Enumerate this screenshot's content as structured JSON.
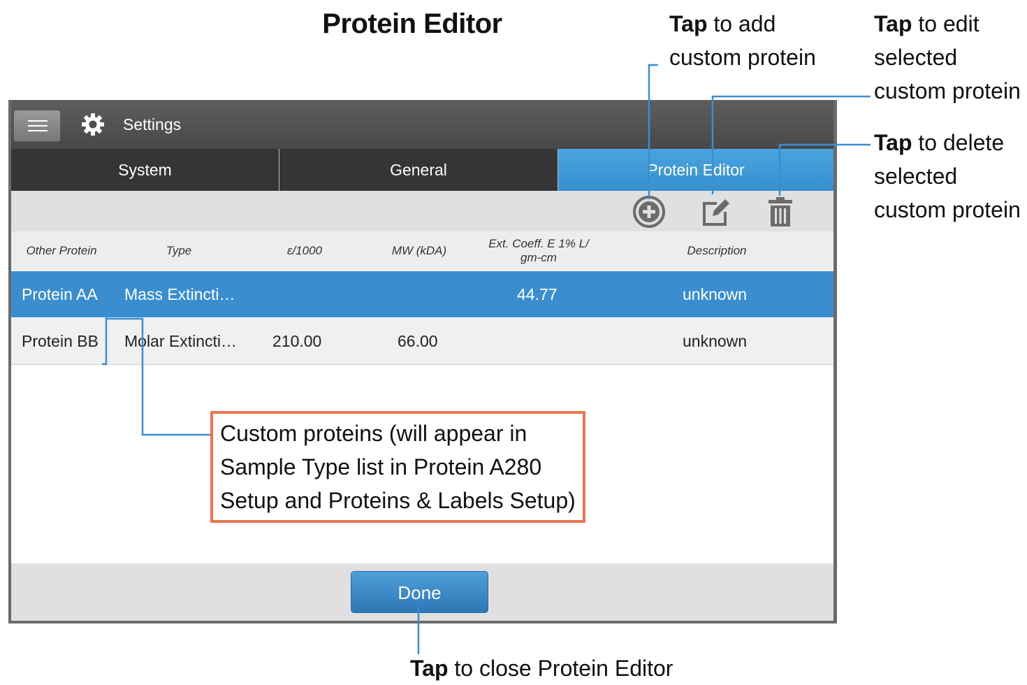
{
  "page_title": "Protein Editor",
  "callouts": {
    "add": {
      "bold": "Tap",
      "rest": " to add",
      "line2": "custom protein"
    },
    "edit": {
      "bold": "Tap",
      "rest": " to edit",
      "line2": "selected",
      "line3": "custom protein"
    },
    "delete": {
      "bold": "Tap",
      "rest": " to delete",
      "line2": "selected",
      "line3": "custom protein"
    },
    "close": {
      "bold": "Tap",
      "rest": " to close Protein Editor"
    }
  },
  "note": {
    "line1": "Custom proteins (will appear in",
    "line2": "Sample Type list in Protein A280",
    "line3": "Setup and Proteins & Labels Setup)"
  },
  "app": {
    "title": "Settings",
    "tabs": [
      {
        "label": "System",
        "active": false
      },
      {
        "label": "General",
        "active": false
      },
      {
        "label": "Protein Editor",
        "active": true
      }
    ],
    "toolbar_icons": [
      "add-circle-icon",
      "edit-icon",
      "trash-icon"
    ],
    "columns": [
      "Other Protein",
      "Type",
      "ε/1000",
      "MW (kDA)",
      "Ext. Coeff. E 1% L/",
      "gm-cm",
      "Description"
    ],
    "rows": [
      {
        "name": "Protein AA",
        "type": "Mass Extincti…",
        "eps": "",
        "mw": "",
        "ext": "44.77",
        "desc": "unknown",
        "selected": true
      },
      {
        "name": "Protein BB",
        "type": "Molar Extincti…",
        "eps": "210.00",
        "mw": "66.00",
        "ext": "",
        "desc": "unknown",
        "selected": false
      }
    ],
    "done_label": "Done"
  },
  "colors": {
    "accent_blue": "#3a8ed0",
    "callout_border": "#e9764f",
    "leader_line": "#3a8ed0"
  }
}
